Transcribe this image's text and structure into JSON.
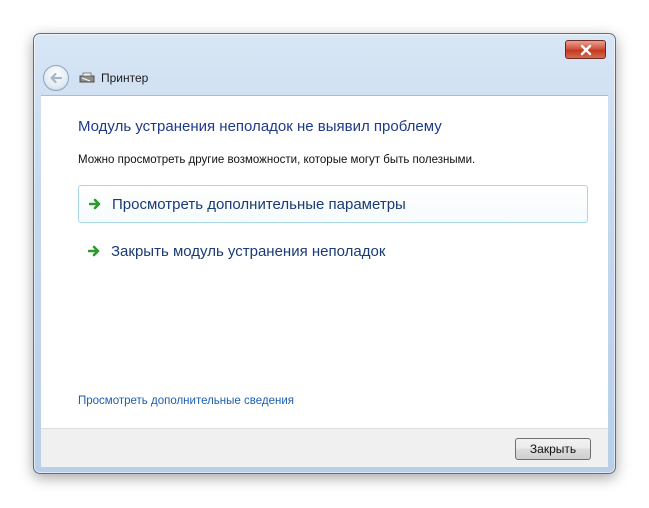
{
  "window": {
    "title": "Принтер",
    "close_tooltip": "Закрыть"
  },
  "main": {
    "heading": "Модуль устранения неполадок не выявил проблему",
    "subtext": "Можно просмотреть другие возможности, которые могут быть полезными.",
    "commands": [
      {
        "label": "Просмотреть дополнительные параметры",
        "icon": "green-arrow-icon"
      },
      {
        "label": "Закрыть модуль устранения неполадок",
        "icon": "green-arrow-icon"
      }
    ],
    "more_info_link": "Просмотреть дополнительные сведения"
  },
  "footer": {
    "close_button": "Закрыть"
  },
  "colors": {
    "heading": "#1e3a8a",
    "link": "#1a5fb4",
    "arrow": "#2e9a2e"
  }
}
